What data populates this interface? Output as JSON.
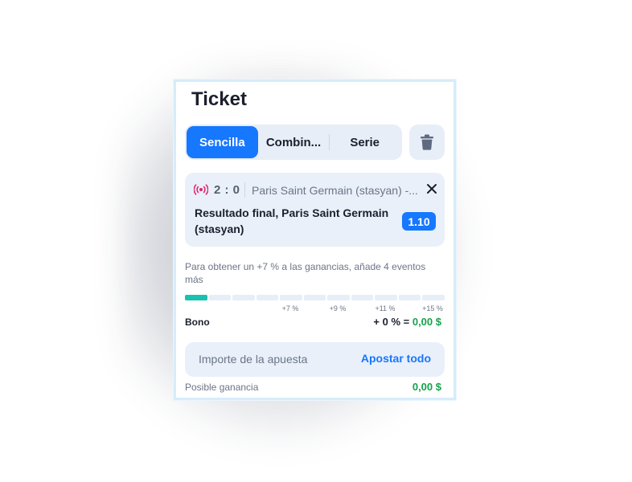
{
  "ticket": {
    "title": "Ticket",
    "tabs": [
      {
        "label": "Sencilla",
        "active": true
      },
      {
        "label": "Combin...",
        "active": false
      },
      {
        "label": "Serie",
        "active": false
      }
    ],
    "delete_icon": "trash-icon"
  },
  "event": {
    "live_icon": "live-broadcast-icon",
    "score": "2 : 0",
    "teams": "Paris Saint Germain (stasyan) -...",
    "close_icon": "close-icon",
    "market": "Resultado final, Paris Saint Germain (stasyan)",
    "odds": "1.10"
  },
  "bonus": {
    "promo_text": "Para obtener un +7 % a las ganancias, añade 4 eventos más",
    "progress_segments": 11,
    "progress_filled": 1,
    "ticks": [
      "+7 %",
      "+9 %",
      "+11 %",
      "+15 %"
    ],
    "label": "Bono",
    "value_prefix": "+ 0 % =",
    "value_amount": "0,00 $"
  },
  "stake": {
    "placeholder": "Importe de la apuesta",
    "bet_all_label": "Apostar todo"
  },
  "gain": {
    "label": "Posible ganancia",
    "value": "0,00 $"
  },
  "colors": {
    "accent": "#1677ff",
    "progress": "#19c1b0",
    "positive": "#17a34a",
    "live": "#e3246b"
  }
}
